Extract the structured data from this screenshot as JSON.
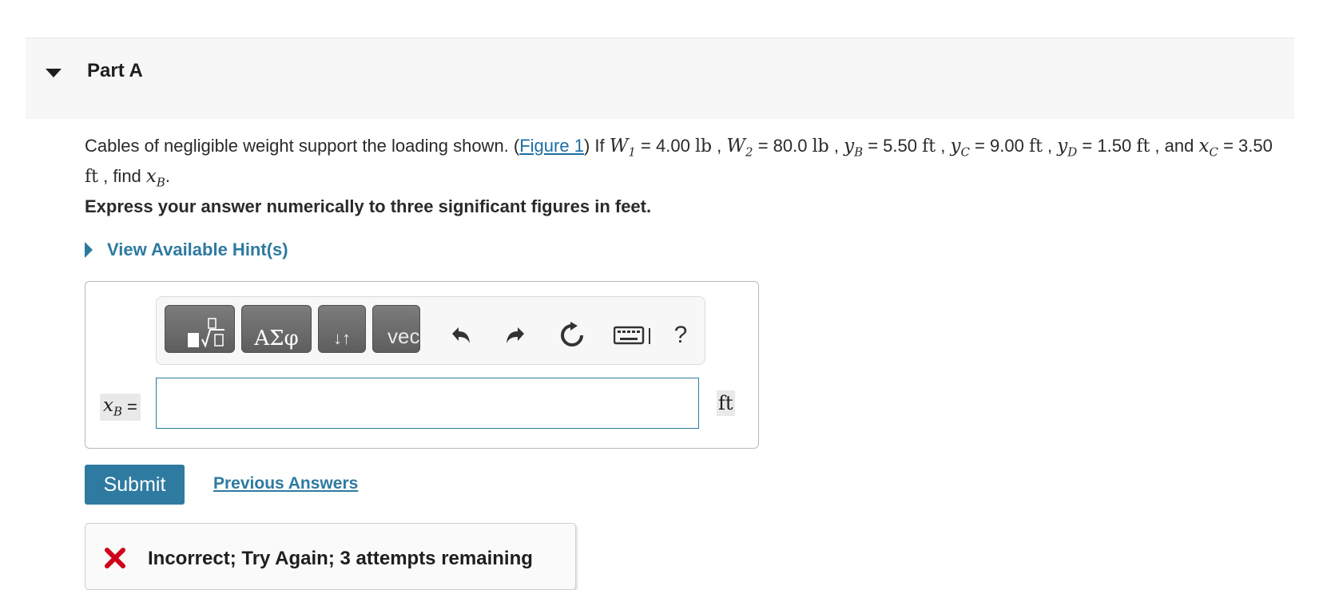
{
  "part": {
    "title": "Part A"
  },
  "question": {
    "intro": "Cables of negligible weight support the loading shown. (",
    "figure_link": "Figure 1",
    "after_link": ") If ",
    "w1_sym": "W",
    "w1_sub": "1",
    "w1_eq": " = 4.00 ",
    "w1_unit": "lb",
    "sep1": " , ",
    "w2_sym": "W",
    "w2_sub": "2",
    "w2_eq": " = 80.0 ",
    "w2_unit": "lb",
    "sep2": " , ",
    "yb_sym": "y",
    "yb_sub": "B",
    "yb_eq": " = 5.50 ",
    "yb_unit": "ft",
    "sep3": " , ",
    "yc_sym": "y",
    "yc_sub": "C",
    "yc_eq": " = 9.00 ",
    "yc_unit": "ft",
    "sep4": " , ",
    "yd_sym": "y",
    "yd_sub": "D",
    "yd_eq": " = 1.50 ",
    "yd_unit": "ft",
    "sep5": " , ",
    "and": "and ",
    "xc_sym": "x",
    "xc_sub": "C",
    "xc_eq": " = 3.50 ",
    "xc_unit": "ft",
    "find": " , find ",
    "xb_sym": "x",
    "xb_sub": "B",
    "end": "."
  },
  "instruction": "Express your answer numerically to three significant figures in feet.",
  "hint": {
    "label": "View Available Hint(s)"
  },
  "toolbar": {
    "greek_label": "ΑΣφ",
    "arrows_label": "↓↑",
    "vec_label": "vec",
    "help_label": "?"
  },
  "answer": {
    "var_sym": "x",
    "var_sub": "B",
    "eq": "=",
    "value": "",
    "unit": "ft"
  },
  "actions": {
    "submit_label": "Submit",
    "previous_label": "Previous Answers"
  },
  "feedback": {
    "text": "Incorrect; Try Again; 3 attempts remaining",
    "color": "#d0021b"
  },
  "colors": {
    "accent": "#2d7aa0",
    "header_bg": "#f7f7f7",
    "link": "#1c6ea4"
  }
}
